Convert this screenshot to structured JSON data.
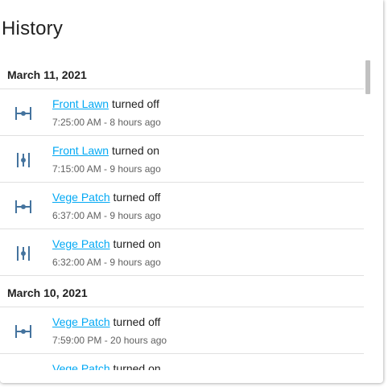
{
  "title": "History",
  "colors": {
    "link": "#03a9f4",
    "icon": "#44739e",
    "divider": "#e0e0e0"
  },
  "groups": [
    {
      "date": "March 11, 2021",
      "entries": [
        {
          "entity": "Front Lawn",
          "action": "turned off",
          "time": "7:25:00 AM - 8 hours ago",
          "icon": "valve-closed-icon"
        },
        {
          "entity": "Front Lawn",
          "action": "turned on",
          "time": "7:15:00 AM - 9 hours ago",
          "icon": "valve-open-icon"
        },
        {
          "entity": "Vege Patch",
          "action": "turned off",
          "time": "6:37:00 AM - 9 hours ago",
          "icon": "valve-closed-icon"
        },
        {
          "entity": "Vege Patch",
          "action": "turned on",
          "time": "6:32:00 AM - 9 hours ago",
          "icon": "valve-open-icon"
        }
      ]
    },
    {
      "date": "March 10, 2021",
      "entries": [
        {
          "entity": "Vege Patch",
          "action": "turned off",
          "time": "7:59:00 PM - 20 hours ago",
          "icon": "valve-closed-icon"
        },
        {
          "entity": "Vege Patch",
          "action": "turned on",
          "time": "",
          "icon": "valve-open-icon"
        }
      ]
    }
  ]
}
